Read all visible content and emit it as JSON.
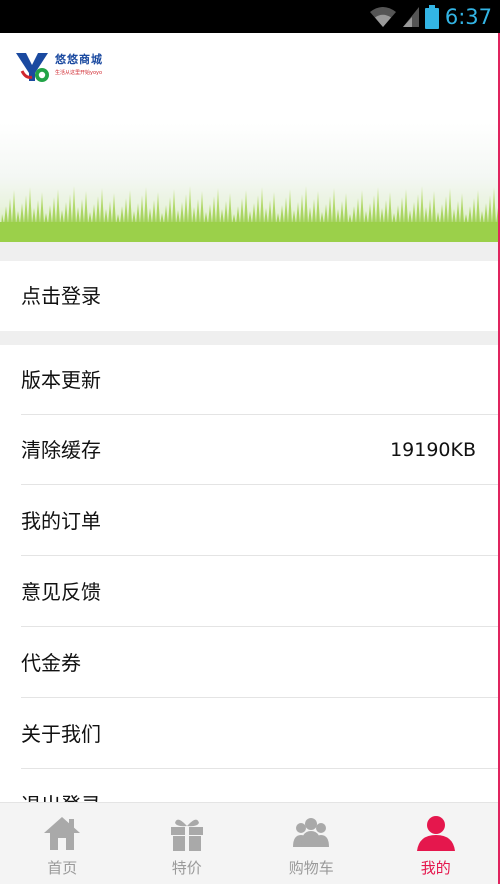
{
  "status_bar": {
    "time": "6:37"
  },
  "header": {
    "logo_name": "悠悠商城",
    "logo_subtitle": "生活从这里开始yoyo"
  },
  "login": {
    "label": "点击登录"
  },
  "menu": [
    {
      "label": "版本更新",
      "value": ""
    },
    {
      "label": "清除缓存",
      "value": "19190KB"
    },
    {
      "label": "我的订单",
      "value": ""
    },
    {
      "label": "意见反馈",
      "value": ""
    },
    {
      "label": "代金券",
      "value": ""
    },
    {
      "label": "关于我们",
      "value": ""
    },
    {
      "label": "退出登录",
      "value": ""
    }
  ],
  "tabs": [
    {
      "label": "首页",
      "icon": "home-icon",
      "active": false
    },
    {
      "label": "特价",
      "icon": "gift-icon",
      "active": false
    },
    {
      "label": "购物车",
      "icon": "group-icon",
      "active": false
    },
    {
      "label": "我的",
      "icon": "person-icon",
      "active": true
    }
  ],
  "colors": {
    "accent": "#e5174d",
    "status_time": "#33b5e5",
    "inactive_tab": "#9a9a9a"
  }
}
